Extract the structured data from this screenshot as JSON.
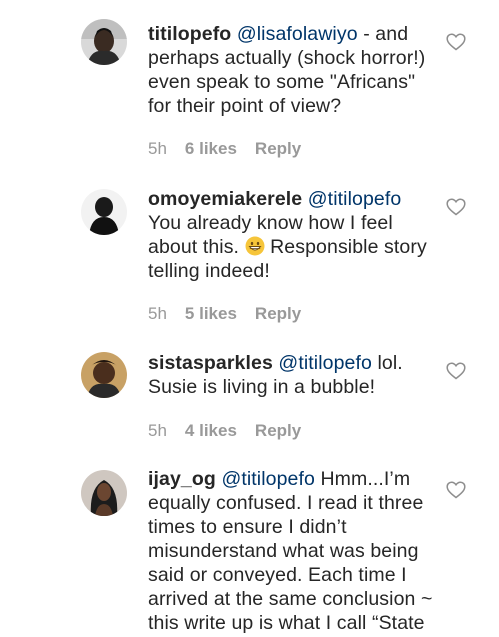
{
  "comments": [
    {
      "username": "titilopefo",
      "mention": "@lisafolawiyo",
      "text": " - and perhaps actually (shock horror!) even speak to some \"Africans\" for their point of view?",
      "time": "5h",
      "likes": "6 likes",
      "reply": "Reply"
    },
    {
      "username": "omoyemiakerele",
      "mention": "@titilopefo",
      "text_before_emoji": " You already know how I feel about this. ",
      "emoji": "grinning-face-emoji",
      "text_after_emoji": " Responsible story telling indeed!",
      "time": "5h",
      "likes": "5 likes",
      "reply": "Reply"
    },
    {
      "username": "sistasparkles",
      "mention": "@titilopefo",
      "text": " lol. Susie is living in a bubble!",
      "time": "5h",
      "likes": "4 likes",
      "reply": "Reply"
    },
    {
      "username": "ijay_og",
      "mention": "@titilopefo",
      "text": " Hmm...I’m equally confused. I read it three times to ensure I didn’t misunderstand what was being said or conveyed. Each time I arrived at the same conclusion ~ this write up is what I call “State"
    }
  ],
  "colors": {
    "text": "#262626",
    "mention": "#003569",
    "meta": "#999999"
  },
  "icons": {
    "like": "heart-outline-icon"
  }
}
